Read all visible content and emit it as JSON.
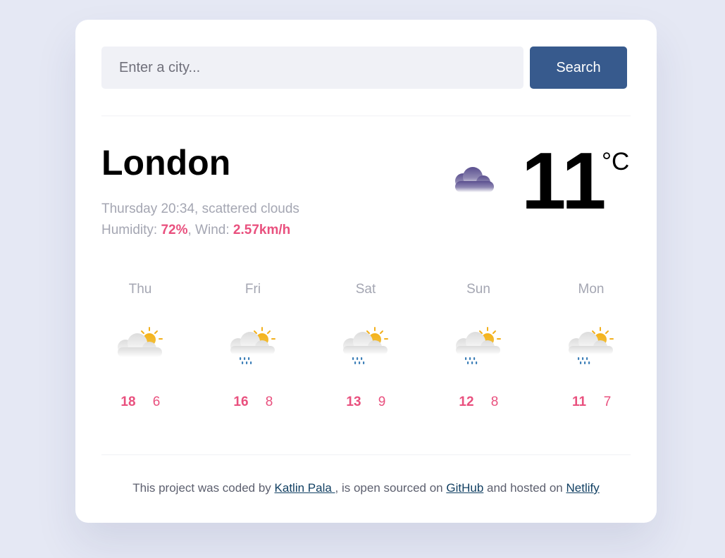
{
  "search": {
    "placeholder": "Enter a city...",
    "button_label": "Search"
  },
  "current": {
    "city": "London",
    "datetime_desc": "Thursday 20:34, scattered clouds",
    "humidity_label": "Humidity: ",
    "humidity_value": "72%",
    "wind_label": ", Wind: ",
    "wind_value": "2.57km/h",
    "temperature": "11",
    "unit": "°C",
    "icon": "cloud-icon"
  },
  "forecast": [
    {
      "day": "Thu",
      "high": "18",
      "low": "6",
      "icon": "partly-cloudy-icon"
    },
    {
      "day": "Fri",
      "high": "16",
      "low": "8",
      "icon": "partly-cloudy-rain-icon"
    },
    {
      "day": "Sat",
      "high": "13",
      "low": "9",
      "icon": "partly-cloudy-rain-icon"
    },
    {
      "day": "Sun",
      "high": "12",
      "low": "8",
      "icon": "partly-cloudy-rain-icon"
    },
    {
      "day": "Mon",
      "high": "11",
      "low": "7",
      "icon": "partly-cloudy-rain-icon"
    }
  ],
  "footer": {
    "text1": "This project was coded by ",
    "author_link": "Katlin Pala ",
    "text2": ", is open sourced on ",
    "github_link": "GitHub",
    "text3": " and hosted on ",
    "netlify_link": "Netlify"
  },
  "colors": {
    "background": "#e5e8f4",
    "accent": "#e9507e",
    "button": "#375a8d",
    "muted_text": "#a4a6b2"
  }
}
